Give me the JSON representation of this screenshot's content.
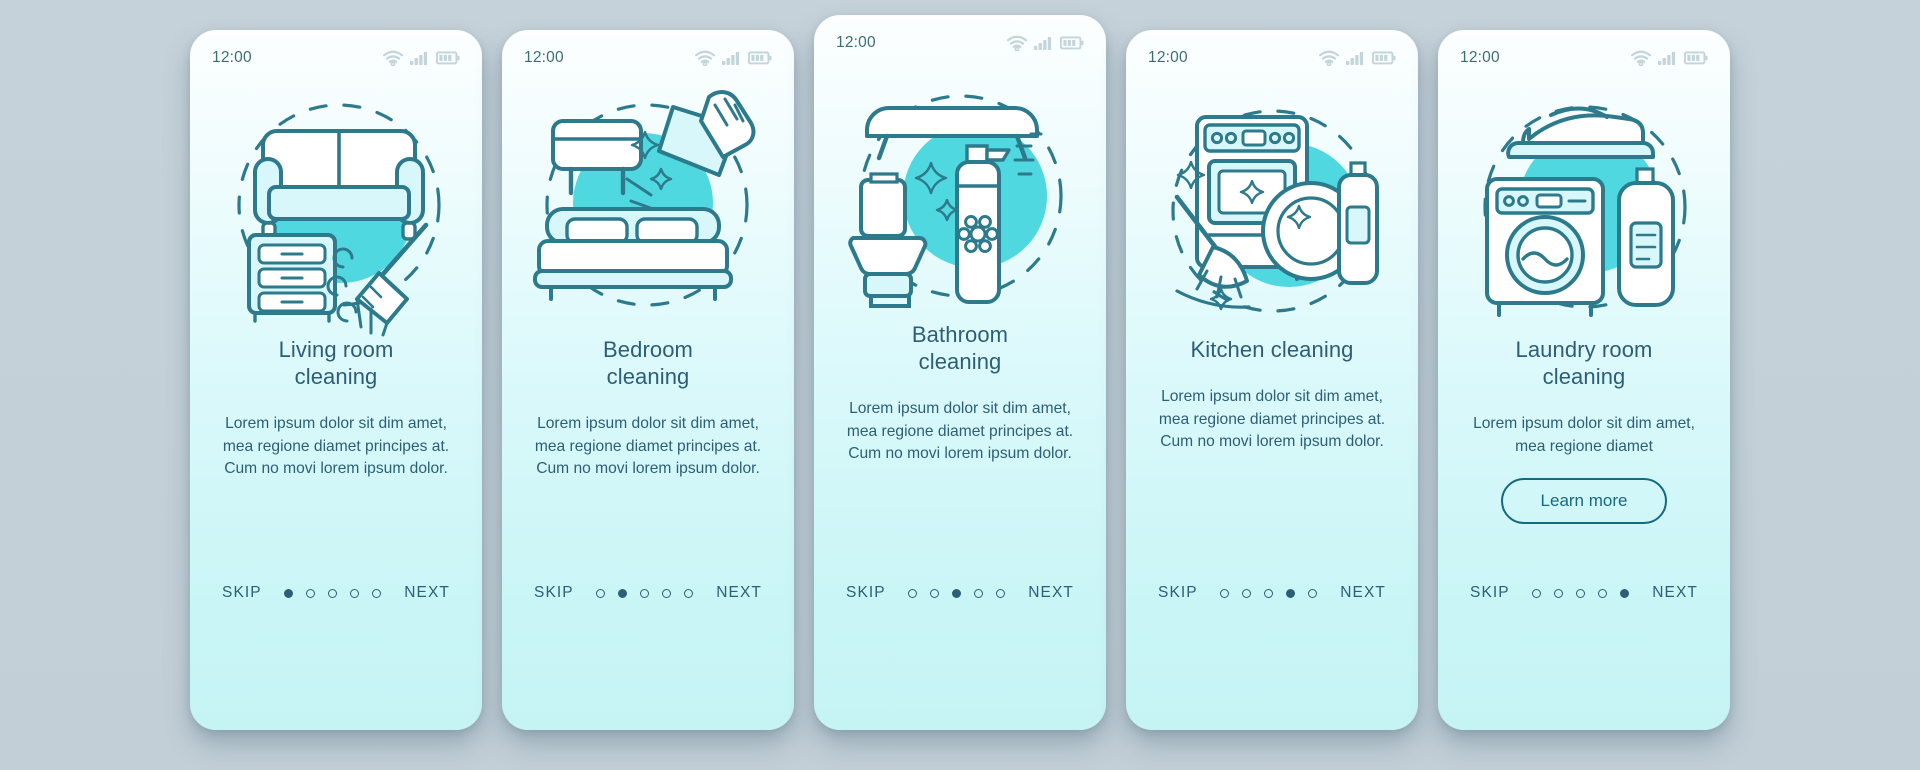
{
  "theme": {
    "page_background": "#c4d1d9",
    "card_top": "#fcfeff",
    "card_bottom": "#c6f4f5",
    "accent_outline": "#2c7a8c",
    "accent_fill": "#4fd8e0",
    "text": "#2c5f77",
    "button_border": "#16697f"
  },
  "status": {
    "time": "12:00",
    "icons": [
      "wifi-icon",
      "signal-icon",
      "battery-icon"
    ]
  },
  "nav": {
    "skip_label": "SKIP",
    "next_label": "NEXT",
    "dot_count": 5
  },
  "screens": [
    {
      "id": "living-room",
      "illustration": "living-room-cleaning-illustration",
      "title": "Living room\ncleaning",
      "description": "Lorem ipsum dolor sit dim amet, mea regione diamet principes at. Cum no movi lorem ipsum dolor.",
      "active_dot": 1,
      "has_learn_more": false,
      "raised": false
    },
    {
      "id": "bedroom",
      "illustration": "bedroom-cleaning-illustration",
      "title": "Bedroom\ncleaning",
      "description": "Lorem ipsum dolor sit dim amet, mea regione diamet principes at. Cum no movi lorem ipsum dolor.",
      "active_dot": 2,
      "has_learn_more": false,
      "raised": false
    },
    {
      "id": "bathroom",
      "illustration": "bathroom-cleaning-illustration",
      "title": "Bathroom\ncleaning",
      "description": "Lorem ipsum dolor sit dim amet, mea regione diamet principes at. Cum no movi lorem ipsum dolor.",
      "active_dot": 3,
      "has_learn_more": false,
      "raised": true
    },
    {
      "id": "kitchen",
      "illustration": "kitchen-cleaning-illustration",
      "title": "Kitchen cleaning",
      "description": "Lorem ipsum dolor sit dim amet, mea regione diamet principes at. Cum no movi lorem ipsum dolor.",
      "active_dot": 4,
      "has_learn_more": false,
      "raised": false
    },
    {
      "id": "laundry-room",
      "illustration": "laundry-room-cleaning-illustration",
      "title": "Laundry room\ncleaning",
      "description": "Lorem ipsum dolor sit dim amet, mea regione diamet",
      "active_dot": 5,
      "has_learn_more": true,
      "learn_more_label": "Learn more",
      "raised": false
    }
  ]
}
